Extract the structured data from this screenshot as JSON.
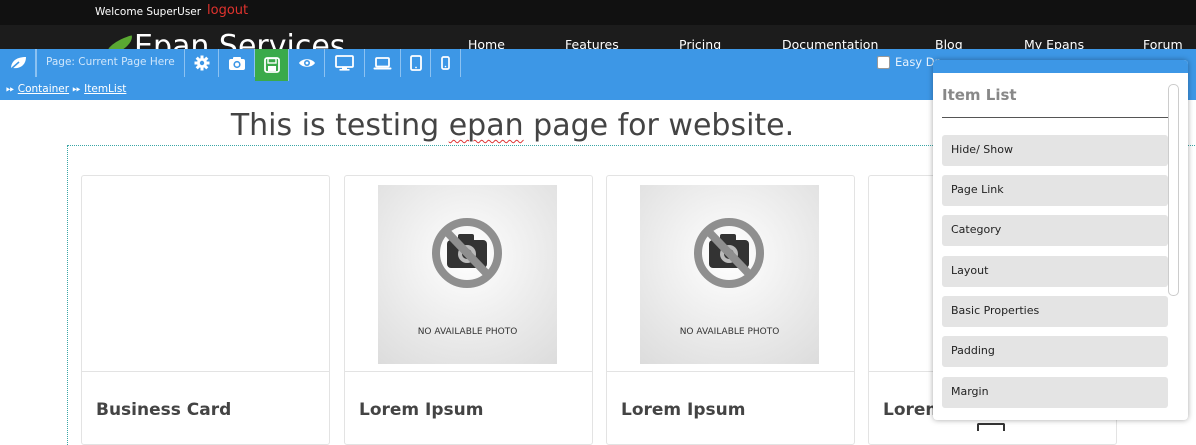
{
  "topbar": {
    "welcome": "Welcome SuperUser",
    "logout": "logout"
  },
  "site": {
    "brand": "Epan Services",
    "nav": [
      "Home",
      "Features",
      "Pricing",
      "Documentation",
      "Blog",
      "My Epans",
      "Forum"
    ]
  },
  "toolbar": {
    "page_label": "Page: Current Page Here",
    "buttons": [
      "leaf-icon",
      "gear-icon",
      "camera-icon",
      "save-icon",
      "eye-icon",
      "desktop-icon",
      "laptop-icon",
      "tablet-icon",
      "mobile-icon"
    ],
    "easy_drop_label": "Easy Dr",
    "accent_color": "#3d97e6",
    "save_color": "#3aaa4a"
  },
  "breadcrumb": {
    "items": [
      "Container",
      "ItemList"
    ]
  },
  "page": {
    "heading_part1": "This is testing ",
    "heading_misspelled": "epan",
    "heading_part2": " page for website."
  },
  "cards": [
    {
      "title": "Business Card",
      "has_photo": false
    },
    {
      "title": "Lorem Ipsum",
      "has_photo": true,
      "photo_text": "NO AVAILABLE PHOTO"
    },
    {
      "title": "Lorem Ipsum",
      "has_photo": true,
      "photo_text": "NO AVAILABLE PHOTO"
    },
    {
      "title": "Lorem",
      "has_photo": false
    }
  ],
  "panel": {
    "title": "Item List",
    "items": [
      "Hide/ Show",
      "Page Link",
      "Category",
      "Layout",
      "Basic Properties",
      "Padding",
      "Margin"
    ]
  }
}
